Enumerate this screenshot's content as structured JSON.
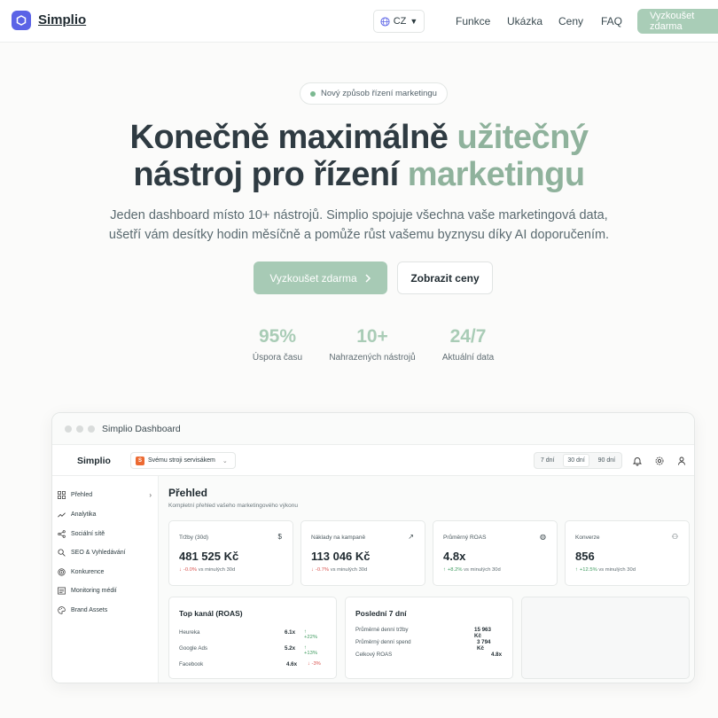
{
  "nav": {
    "brand": "Simplio",
    "lang": "CZ",
    "links": [
      "Funkce",
      "Ukázka",
      "Ceny",
      "FAQ"
    ],
    "cta": "Vyzkoušet zdarma"
  },
  "hero": {
    "pill": "Nový způsob řízení marketingu",
    "title_line1_dark": "Konečně maximálně ",
    "title_line1_green": "užitečný",
    "title_line2_dark": "nástroj pro řízení ",
    "title_line2_green": "marketingu",
    "subtitle_line1": "Jeden dashboard místo 10+ nástrojů. Simplio spojuje všechna vaše marketingová data,",
    "subtitle_line2": "ušetří vám desítky hodin měsíčně a pomůže růst vašemu byznysu díky AI doporučením.",
    "primary_button": "Vyzkoušet zdarma",
    "secondary_button": "Zobrazit ceny",
    "stats": [
      {
        "value": "95%",
        "label": "Úspora času"
      },
      {
        "value": "10+",
        "label": "Nahrazených nástrojů"
      },
      {
        "value": "24/7",
        "label": "Aktuální data"
      }
    ],
    "colors": {
      "accent_green": "#a7cab5",
      "dark_text": "#2f3b42"
    }
  },
  "dashboard": {
    "window_title": "Simplio Dashboard",
    "brand": "Simplio",
    "company_badge": "S",
    "company_name": "Svému stroji servisákem",
    "ranges": [
      "7 dní",
      "30 dní",
      "90 dní"
    ],
    "active_range": "30 dní",
    "sidebar": [
      {
        "label": "Přehled",
        "icon": "grid-icon"
      },
      {
        "label": "Analytika",
        "icon": "trend-icon"
      },
      {
        "label": "Sociální sítě",
        "icon": "share-icon"
      },
      {
        "label": "SEO & Vyhledávání",
        "icon": "search-icon"
      },
      {
        "label": "Konkurence",
        "icon": "target-icon"
      },
      {
        "label": "Monitoring médií",
        "icon": "newspaper-icon"
      },
      {
        "label": "Brand Assets",
        "icon": "palette-icon"
      }
    ],
    "title": "Přehled",
    "subtitle": "Kompletní přehled vašeho marketingového výkonu",
    "kpis": [
      {
        "label": "Tržby (30d)",
        "icon": "$",
        "value": "481 525 Kč",
        "delta": "-0.0%",
        "dir": "down",
        "vs": "vs minulých 30d"
      },
      {
        "label": "Náklady na kampaně",
        "icon": "↗",
        "value": "113 046 Kč",
        "delta": "-0.7%",
        "dir": "down",
        "vs": "vs minulých 30d"
      },
      {
        "label": "Průměrný ROAS",
        "icon": "◍",
        "value": "4.8x",
        "delta": "+8.2%",
        "dir": "up",
        "vs": "vs minulých 30d"
      },
      {
        "label": "Konverze",
        "icon": "⚇",
        "value": "856",
        "delta": "+12.5%",
        "dir": "up",
        "vs": "vs minulých 30d"
      }
    ],
    "top_channel": {
      "title": "Top kanál (ROAS)",
      "rows": [
        {
          "name": "Heureka",
          "value": "6.1x",
          "change": "+22%",
          "dir": "up"
        },
        {
          "name": "Google Ads",
          "value": "5.2x",
          "change": "+13%",
          "dir": "up"
        },
        {
          "name": "Facebook",
          "value": "4.6x",
          "change": "-3%",
          "dir": "down"
        }
      ]
    },
    "last7": {
      "title": "Poslední 7 dní",
      "rows": [
        {
          "name": "Průměrné denní tržby",
          "value": "15 963 Kč"
        },
        {
          "name": "Průměrný denní spend",
          "value": "3 794 Kč"
        },
        {
          "name": "Celkový ROAS",
          "value": "4.8x"
        }
      ]
    }
  }
}
